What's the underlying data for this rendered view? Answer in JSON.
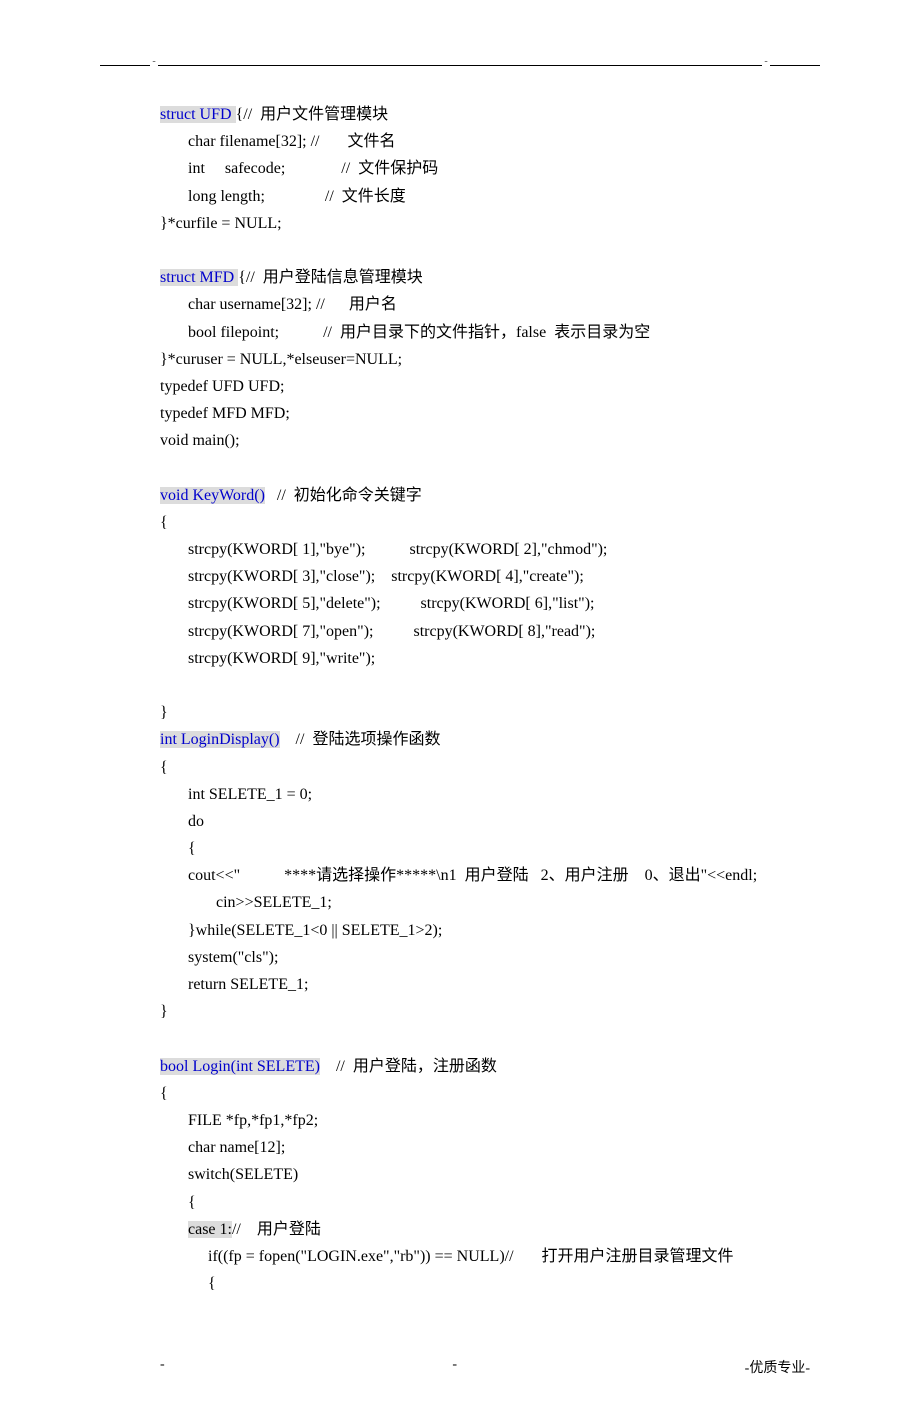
{
  "lines": [
    {
      "parts": [
        {
          "t": "struct UFD ",
          "cls": "hl"
        },
        {
          "t": "{//  用户文件管理模块"
        }
      ]
    },
    {
      "parts": [
        {
          "t": "       char filename[32]; //       文件名"
        }
      ]
    },
    {
      "parts": [
        {
          "t": "       int     safecode;              //  文件保护码"
        }
      ]
    },
    {
      "parts": [
        {
          "t": "       long length;               //  文件长度"
        }
      ]
    },
    {
      "parts": [
        {
          "t": "}*curfile = NULL;"
        }
      ]
    },
    {
      "parts": [
        {
          "t": ""
        }
      ]
    },
    {
      "parts": [
        {
          "t": "struct MFD ",
          "cls": "hl"
        },
        {
          "t": "{//  用户登陆信息管理模块"
        }
      ]
    },
    {
      "parts": [
        {
          "t": "       char username[32]; //      用户名"
        }
      ]
    },
    {
      "parts": [
        {
          "t": "       bool filepoint;           //  用户目录下的文件指针，false  表示目录为空"
        }
      ]
    },
    {
      "parts": [
        {
          "t": "}*curuser = NULL,*elseuser=NULL;"
        }
      ]
    },
    {
      "parts": [
        {
          "t": "typedef UFD UFD;"
        }
      ]
    },
    {
      "parts": [
        {
          "t": "typedef MFD MFD;"
        }
      ]
    },
    {
      "parts": [
        {
          "t": "void main();"
        }
      ]
    },
    {
      "parts": [
        {
          "t": ""
        }
      ]
    },
    {
      "parts": [
        {
          "t": "void KeyWord()",
          "cls": "hl"
        },
        {
          "t": "   //  初始化命令关键字"
        }
      ]
    },
    {
      "parts": [
        {
          "t": "{"
        }
      ]
    },
    {
      "parts": [
        {
          "t": "       strcpy(KWORD[ 1],\"bye\");           strcpy(KWORD[ 2],\"chmod\");"
        }
      ]
    },
    {
      "parts": [
        {
          "t": "       strcpy(KWORD[ 3],\"close\");    strcpy(KWORD[ 4],\"create\");"
        }
      ]
    },
    {
      "parts": [
        {
          "t": "       strcpy(KWORD[ 5],\"delete\");          strcpy(KWORD[ 6],\"list\");"
        }
      ]
    },
    {
      "parts": [
        {
          "t": "       strcpy(KWORD[ 7],\"open\");          strcpy(KWORD[ 8],\"read\");"
        }
      ]
    },
    {
      "parts": [
        {
          "t": "       strcpy(KWORD[ 9],\"write\");"
        }
      ]
    },
    {
      "parts": [
        {
          "t": ""
        }
      ]
    },
    {
      "parts": [
        {
          "t": "}"
        }
      ]
    },
    {
      "parts": [
        {
          "t": "int LoginDisplay()",
          "cls": "hl"
        },
        {
          "t": "    //  登陆选项操作函数"
        }
      ]
    },
    {
      "parts": [
        {
          "t": "{"
        }
      ]
    },
    {
      "parts": [
        {
          "t": "       int SELETE_1 = 0;"
        }
      ]
    },
    {
      "parts": [
        {
          "t": "       do"
        }
      ]
    },
    {
      "parts": [
        {
          "t": "       {"
        }
      ]
    },
    {
      "parts": [
        {
          "t": "       cout<<\"           ****请选择操作*****\\n1  用户登陆   2、用户注册    0、退出\"<<endl;"
        }
      ]
    },
    {
      "parts": [
        {
          "t": "              cin>>SELETE_1;"
        }
      ]
    },
    {
      "parts": [
        {
          "t": "       }while(SELETE_1<0 || SELETE_1>2);"
        }
      ]
    },
    {
      "parts": [
        {
          "t": "       system(\"cls\");"
        }
      ]
    },
    {
      "parts": [
        {
          "t": "       return SELETE_1;"
        }
      ]
    },
    {
      "parts": [
        {
          "t": "}"
        }
      ]
    },
    {
      "parts": [
        {
          "t": ""
        }
      ]
    },
    {
      "parts": [
        {
          "t": "bool Login(int SELETE)",
          "cls": "hl"
        },
        {
          "t": "    //  用户登陆，注册函数"
        }
      ]
    },
    {
      "parts": [
        {
          "t": "{"
        }
      ]
    },
    {
      "parts": [
        {
          "t": "       FILE *fp,*fp1,*fp2;"
        }
      ]
    },
    {
      "parts": [
        {
          "t": "       char name[12];"
        }
      ]
    },
    {
      "parts": [
        {
          "t": "       switch(SELETE)"
        }
      ]
    },
    {
      "parts": [
        {
          "t": "       {"
        }
      ]
    },
    {
      "parts": [
        {
          "t": "       "
        },
        {
          "t": "case 1:",
          "cls": "hl-grey"
        },
        {
          "t": "//    用户登陆"
        }
      ]
    },
    {
      "parts": [
        {
          "t": "            if((fp = fopen(\"LOGIN.exe\",\"rb\")) == NULL)//       打开用户注册目录管理文件"
        }
      ]
    },
    {
      "parts": [
        {
          "t": "            {"
        }
      ]
    }
  ],
  "footer": {
    "left": "-",
    "middle": "-",
    "right": "-优质专业-"
  }
}
